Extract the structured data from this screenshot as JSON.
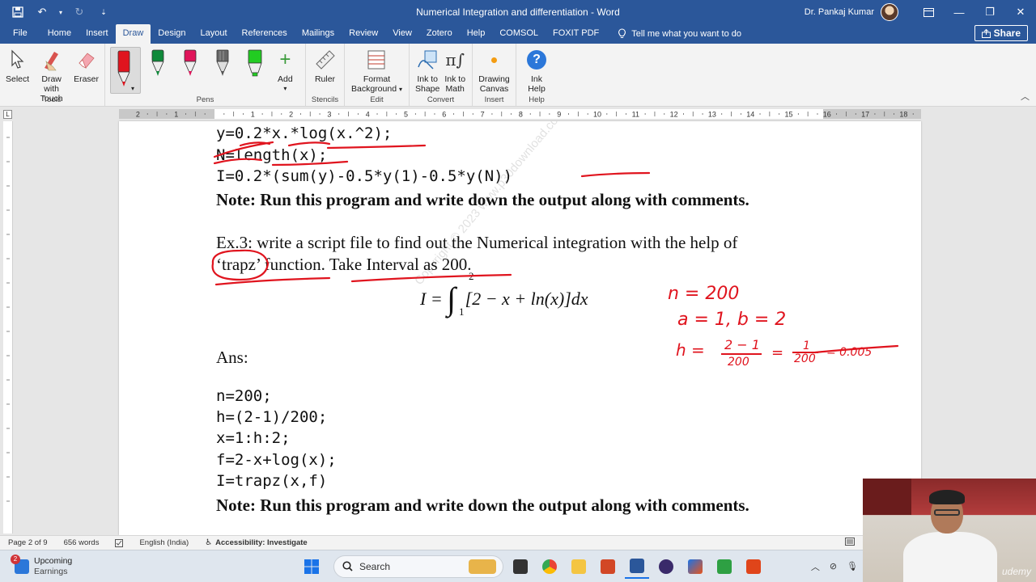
{
  "titlebar": {
    "title": "Numerical Integration and differentiation  -  Word",
    "user": "Dr. Pankaj Kumar"
  },
  "menu": {
    "items": [
      "File",
      "Home",
      "Insert",
      "Draw",
      "Design",
      "Layout",
      "References",
      "Mailings",
      "Review",
      "View",
      "Zotero",
      "Help",
      "COMSOL",
      "FOXIT PDF"
    ],
    "active": "Draw",
    "tell_me": "Tell me what you want to do",
    "share": "Share"
  },
  "ribbon": {
    "tools": {
      "label": "Tools",
      "select": "Select",
      "draw_touch_1": "Draw with",
      "draw_touch_2": "Touch",
      "eraser": "Eraser"
    },
    "pens": {
      "label": "Pens",
      "add": "Add",
      "colors": [
        "#e0141e",
        "#0f8a3a",
        "#e0145a",
        "#666666",
        "#22cc22"
      ]
    },
    "stencils": {
      "label": "Stencils",
      "ruler": "Ruler"
    },
    "edit": {
      "label": "Edit",
      "format_1": "Format",
      "format_2": "Background"
    },
    "convert": {
      "label": "Convert",
      "ink_shape_1": "Ink to",
      "ink_shape_2": "Shape",
      "ink_math_1": "Ink to",
      "ink_math_2": "Math"
    },
    "insert": {
      "label": "Insert",
      "canvas_1": "Drawing",
      "canvas_2": "Canvas"
    },
    "help": {
      "label": "Help",
      "ink_help_1": "Ink",
      "ink_help_2": "Help"
    }
  },
  "ruler_numbers": [
    "2",
    "1",
    "1",
    "2",
    "3",
    "4",
    "5",
    "6",
    "7",
    "8",
    "9",
    "10",
    "11",
    "12",
    "13",
    "14",
    "15",
    "16",
    "17",
    "18"
  ],
  "document": {
    "code_top": [
      "y=0.2*x.*log(x.^2);",
      "N=length(x);",
      "I=0.2*(sum(y)-0.5*y(1)-0.5*y(N))"
    ],
    "note1": "Note: Run this program and write down the output along with comments.",
    "ex3_line1": "Ex.3: write a script file to find out the Numerical integration with the help of",
    "ex3_line2": "‘trapz’ function. Take Interval as 200.",
    "formula_lhs": "I =",
    "formula_upper": "2",
    "formula_lower": "1",
    "formula_body": "[2 − x + ln(x)]dx",
    "ans": "Ans:",
    "code_ans": [
      "n=200;",
      "h=(2-1)/200;",
      "x=1:h:2;",
      "f=2-x+log(x);",
      "I=trapz(x,f)"
    ],
    "note2": "Note: Run this program and write down the output along with comments.",
    "watermark": "Copyright © 2023 www.p30download.com"
  },
  "handwriting": {
    "n": "n = 200",
    "ab": "a = 1, b = 2",
    "h_label": "h =",
    "h_frac1_num": "2 − 1",
    "h_frac1_den": "200",
    "h_frac2_num": "1",
    "h_frac2_den": "200",
    "h_result": "= 0.005",
    "ink_color": "#e0141e"
  },
  "statusbar": {
    "page": "Page 2 of 9",
    "words": "656 words",
    "language": "English (India)",
    "accessibility": "Accessibility: Investigate"
  },
  "taskbar": {
    "weather_title": "Upcoming",
    "weather_sub": "Earnings",
    "badge": "2",
    "search": "Search"
  },
  "webcam": {
    "logo": "udemy"
  }
}
